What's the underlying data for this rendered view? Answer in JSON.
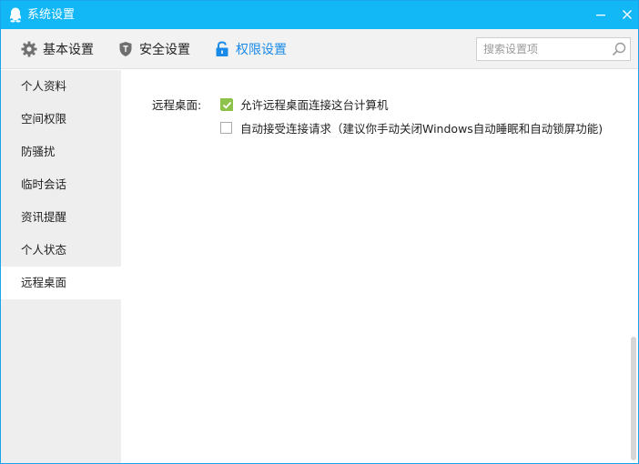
{
  "window": {
    "title": "系统设置",
    "accent_color": "#12b7f5",
    "active_tab_color": "#1a8ae8"
  },
  "tabs": [
    {
      "label": "基本设置",
      "icon": "gear-icon"
    },
    {
      "label": "安全设置",
      "icon": "shield-icon"
    },
    {
      "label": "权限设置",
      "icon": "lock-icon",
      "active": true
    }
  ],
  "search": {
    "placeholder": "搜索设置项",
    "value": ""
  },
  "sidebar": {
    "items": [
      {
        "label": "个人资料"
      },
      {
        "label": "空间权限"
      },
      {
        "label": "防骚扰"
      },
      {
        "label": "临时会话"
      },
      {
        "label": "资讯提醒"
      },
      {
        "label": "个人状态"
      },
      {
        "label": "远程桌面",
        "active": true
      }
    ]
  },
  "content": {
    "section_label": "远程桌面:",
    "options": [
      {
        "label": "允许远程桌面连接这台计算机",
        "checked": true
      },
      {
        "label": "自动接受连接请求（建议你手动关闭Windows自动睡眠和自动锁屏功能)",
        "checked": false
      }
    ]
  }
}
